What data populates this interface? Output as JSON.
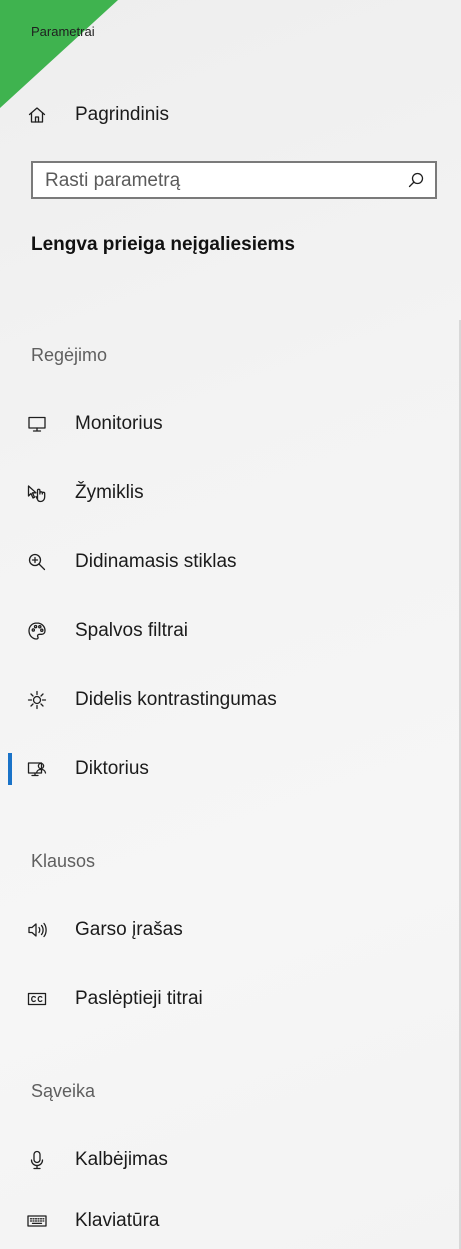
{
  "app": {
    "title": "Parametrai"
  },
  "home": {
    "label": "Pagrindinis",
    "icon": "home-icon"
  },
  "search": {
    "placeholder": "Rasti parametrą",
    "value": "",
    "icon": "search-icon"
  },
  "section": {
    "title": "Lengva prieiga neįgaliesiems"
  },
  "groups": [
    {
      "heading": "Regėjimo",
      "items": [
        {
          "label": "Monitorius",
          "icon": "monitor-icon",
          "active": false
        },
        {
          "label": "Žymiklis",
          "icon": "pointer-icon",
          "active": false
        },
        {
          "label": "Didinamasis stiklas",
          "icon": "magnifier-icon",
          "active": false
        },
        {
          "label": "Spalvos filtrai",
          "icon": "color-palette-icon",
          "active": false
        },
        {
          "label": "Didelis kontrastingumas",
          "icon": "high-contrast-icon",
          "active": false
        },
        {
          "label": "Diktorius",
          "icon": "narrator-icon",
          "active": true
        }
      ]
    },
    {
      "heading": "Klausos",
      "items": [
        {
          "label": "Garso įrašas",
          "icon": "speaker-icon",
          "active": false
        },
        {
          "label": "Paslėptieji titrai",
          "icon": "closed-captions-icon",
          "active": false
        }
      ]
    },
    {
      "heading": "Sąveika",
      "items": [
        {
          "label": "Kalbėjimas",
          "icon": "microphone-icon",
          "active": false
        },
        {
          "label": "Klaviatūra",
          "icon": "keyboard-icon",
          "active": false
        }
      ]
    }
  ],
  "colors": {
    "accent": "#1a73c8",
    "corner": "#3fb34f",
    "background": "#f3f3f3"
  }
}
